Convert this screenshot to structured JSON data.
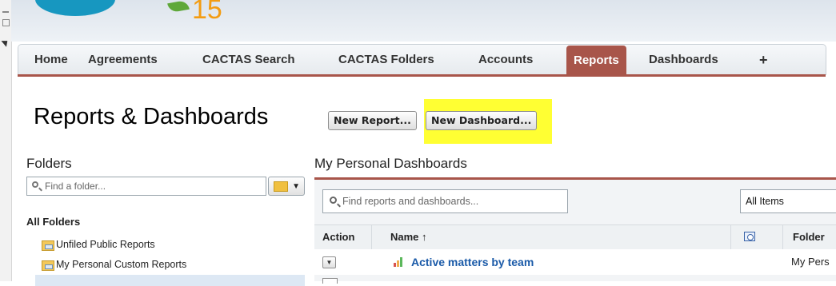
{
  "app": {
    "logo_number": "15"
  },
  "tabs": [
    {
      "label": "Home"
    },
    {
      "label": "Agreements"
    },
    {
      "label": "CACTAS Search"
    },
    {
      "label": "CACTAS Folders"
    },
    {
      "label": "Accounts"
    },
    {
      "label": "Reports",
      "active": true
    },
    {
      "label": "Dashboards"
    },
    {
      "label": "+"
    }
  ],
  "page": {
    "title": "Reports & Dashboards",
    "new_report_label": "New Report...",
    "new_dashboard_label": "New Dashboard..."
  },
  "folders": {
    "title": "Folders",
    "search_placeholder": "Find a folder...",
    "all_folders_label": "All Folders",
    "items": [
      {
        "label": "Unfiled Public Reports"
      },
      {
        "label": "My Personal Custom Reports"
      }
    ]
  },
  "main": {
    "section_title": "My Personal Dashboards",
    "search_placeholder": "Find reports and dashboards...",
    "filter_value": "All Items",
    "columns": {
      "action": "Action",
      "name": "Name ↑",
      "folder": "Folder"
    },
    "rows": [
      {
        "name": "Active matters by team",
        "folder": "My Pers"
      }
    ]
  },
  "colors": {
    "tab_accent": "#a8554a",
    "highlight": "#ffff33",
    "link": "#1a5aa8"
  },
  "icons": [
    "search-icon",
    "folder-icon",
    "schedule-icon",
    "chart-bars-icon",
    "dropdown-arrow-icon"
  ]
}
